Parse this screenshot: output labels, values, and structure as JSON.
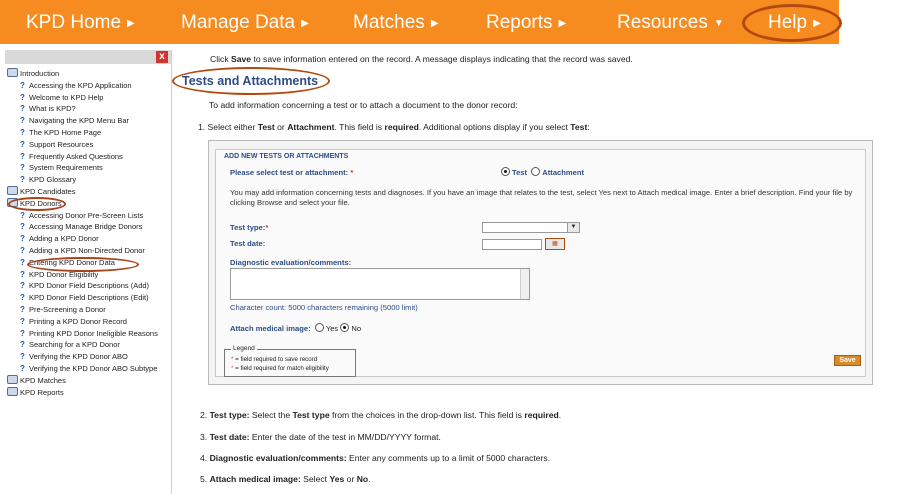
{
  "nav": {
    "items": [
      {
        "label": "KPD Home",
        "arrow": "▶"
      },
      {
        "label": "Manage Data",
        "arrow": "▶"
      },
      {
        "label": "Matches",
        "arrow": "▶"
      },
      {
        "label": "Reports",
        "arrow": "▶"
      },
      {
        "label": "Resources",
        "arrow": "▼"
      },
      {
        "label": "Help",
        "arrow": "▶"
      }
    ]
  },
  "sidebar": {
    "close": "x",
    "items": [
      {
        "type": "book",
        "label": "Introduction"
      },
      {
        "type": "page",
        "label": "Accessing the KPD Application"
      },
      {
        "type": "page",
        "label": "Welcome to KPD Help"
      },
      {
        "type": "page",
        "label": "What is KPD?"
      },
      {
        "type": "page",
        "label": "Navigating the KPD Menu Bar"
      },
      {
        "type": "page",
        "label": "The KPD Home Page"
      },
      {
        "type": "page",
        "label": "Support Resources"
      },
      {
        "type": "page",
        "label": "Frequently Asked Questions"
      },
      {
        "type": "page",
        "label": "System Requirements"
      },
      {
        "type": "page",
        "label": "KPD Glossary"
      },
      {
        "type": "book",
        "label": "KPD Candidates"
      },
      {
        "type": "book",
        "label": "KPD Donors"
      },
      {
        "type": "page",
        "label": "Accessing Donor Pre-Screen Lists"
      },
      {
        "type": "page",
        "label": "Accessing Manage Bridge Donors"
      },
      {
        "type": "page",
        "label": "Adding a KPD Donor"
      },
      {
        "type": "page",
        "label": "Adding a KPD Non-Directed Donor"
      },
      {
        "type": "page",
        "label": "Entering KPD Donor Data"
      },
      {
        "type": "page",
        "label": "KPD Donor Eligibility"
      },
      {
        "type": "page",
        "label": "KPD Donor Field Descriptions (Add)"
      },
      {
        "type": "page",
        "label": "KPD Donor Field Descriptions (Edit)"
      },
      {
        "type": "page",
        "label": "Pre-Screening a Donor"
      },
      {
        "type": "page",
        "label": "Printing a KPD Donor Record"
      },
      {
        "type": "page",
        "label": "Printing KPD Donor Ineligible Reasons"
      },
      {
        "type": "page",
        "label": "Searching for a KPD Donor"
      },
      {
        "type": "page",
        "label": "Verifying the KPD Donor ABO"
      },
      {
        "type": "page",
        "label": "Verifying the KPD Donor ABO Subtype"
      },
      {
        "type": "book",
        "label": "KPD Matches"
      },
      {
        "type": "book",
        "label": "KPD Reports"
      }
    ]
  },
  "content": {
    "top_pre": "Click ",
    "top_bold": "Save",
    "top_post": " to save information entered on the record. A message displays indicating that the record was saved.",
    "section_title": "Tests and Attachments",
    "intro": "To add information concerning a test or to attach a document to the donor record:",
    "step1_pre": "1. Select either ",
    "step1_b1": "Test",
    "step1_mid1": " or ",
    "step1_b2": "Attachment",
    "step1_mid2": ". This field is ",
    "step1_b3": "required",
    "step1_mid3": ". Additional options display if you select ",
    "step1_b4": "Test",
    "step1_post": ":",
    "step2_num": "2. ",
    "step2_b1": "Test type:",
    "step2_mid": " Select the ",
    "step2_b2": "Test type",
    "step2_mid2": " from the choices in the drop-down list. This field is ",
    "step2_b3": "required",
    "step2_post": ".",
    "step3_num": "3. ",
    "step3_b": "Test date:",
    "step3_post": " Enter the date of the test in MM/DD/YYYY format.",
    "step4_num": "4. ",
    "step4_b": "Diagnostic evaluation/comments:",
    "step4_post": " Enter any comments up to a limit of 5000 characters.",
    "step5_num": "5. ",
    "step5_b": "Attach medical image:",
    "step5_mid": " Select ",
    "step5_b2": "Yes",
    "step5_mid2": " or ",
    "step5_b3": "No",
    "step5_post": "."
  },
  "form": {
    "fieldset": "ADD NEW TESTS OR ATTACHMENTS",
    "select_label": "Please select test or attachment:",
    "required_mark": "*",
    "option_test": "Test",
    "option_attachment": "Attachment",
    "selected": "Test",
    "help_text": "You may add information concerning tests and diagnoses. If you have an image that relates to the test, select Yes next to Attach medical image. Enter a brief description. Find your file by clicking Browse and select your file.",
    "test_type_label": "Test type:",
    "test_date_label": "Test date:",
    "diag_label": "Diagnostic evaluation/comments:",
    "char_count": "Character count: 5000 characters remaining (5000 limit)",
    "attach_label": "Attach medical image:",
    "opt_yes": "Yes",
    "opt_no": "No",
    "attach_selected": "No",
    "legend_title": "Legend",
    "legend_line1": "= field required to save record",
    "legend_line2": "= field required for match eligibility",
    "save_label": "Save",
    "calendar_icon": "calendar-icon",
    "colors": {
      "required_red": "#d0342c",
      "required_pink": "#e0508c"
    }
  },
  "colors": {
    "nav_bg": "#f68b1f",
    "highlight": "#b34a0d",
    "title_blue": "#2c4d86"
  }
}
